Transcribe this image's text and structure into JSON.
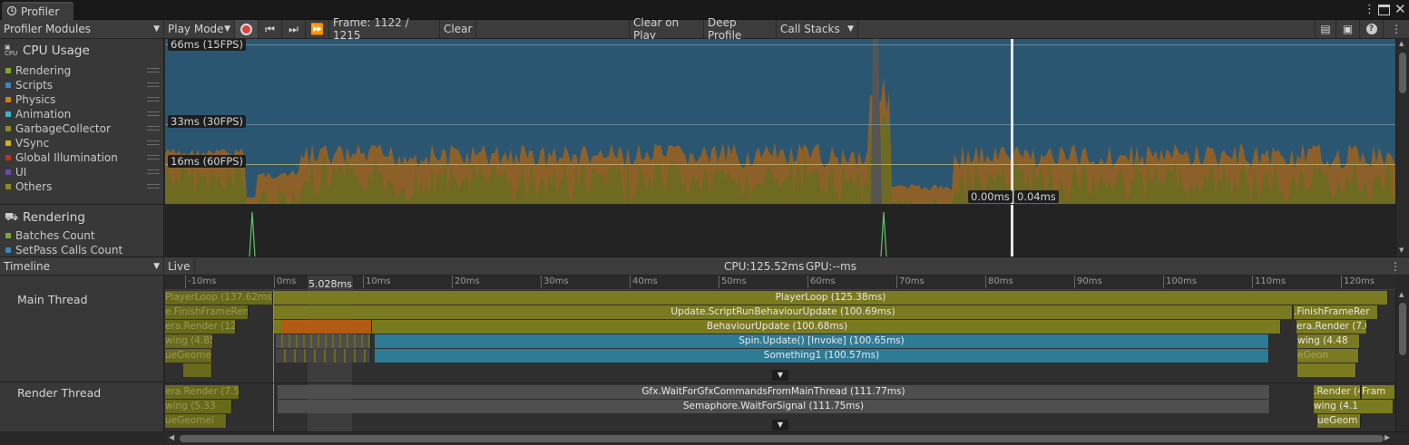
{
  "window": {
    "tab_title": "Profiler"
  },
  "toolbar": {
    "modules_label": "Profiler Modules",
    "play_mode_label": "Play Mode",
    "frame_label": "Frame: 1122 / 1215",
    "clear_label": "Clear",
    "clear_on_play_label": "Clear on Play",
    "deep_profile_label": "Deep Profile",
    "call_stacks_label": "Call Stacks"
  },
  "cpu_module": {
    "title": "CPU Usage",
    "legend": [
      {
        "label": "Rendering",
        "color": "#7fa82a"
      },
      {
        "label": "Scripts",
        "color": "#3a87bf"
      },
      {
        "label": "Physics",
        "color": "#d27b16"
      },
      {
        "label": "Animation",
        "color": "#3bb3c6"
      },
      {
        "label": "GarbageCollector",
        "color": "#8a8a2a"
      },
      {
        "label": "VSync",
        "color": "#d0b21a"
      },
      {
        "label": "Global Illumination",
        "color": "#b0391f"
      },
      {
        "label": "UI",
        "color": "#6a4aa8"
      },
      {
        "label": "Others",
        "color": "#8a8a24"
      }
    ],
    "gridlines": [
      "66ms (15FPS)",
      "33ms (30FPS)",
      "16ms (60FPS)"
    ],
    "selection_left": "0.00ms",
    "selection_right": "0.04ms"
  },
  "rendering_module": {
    "title": "Rendering",
    "legend": [
      {
        "label": "Batches Count",
        "color": "#7fa82a"
      },
      {
        "label": "SetPass Calls Count",
        "color": "#3a87bf"
      }
    ]
  },
  "timeline": {
    "view_label": "Timeline",
    "live_label": "Live",
    "cpu_label": "CPU:125.52ms",
    "gpu_label": "GPU:--ms",
    "selection_duration": "5.028ms",
    "ticks": [
      "-10ms",
      "0ms",
      "10ms",
      "20ms",
      "30ms",
      "40ms",
      "50ms",
      "60ms",
      "70ms",
      "80ms",
      "90ms",
      "100ms",
      "110ms",
      "120ms"
    ],
    "main_thread": {
      "label": "Main Thread",
      "bars": [
        "PlayerLoop (137.62ms)",
        "PlayerLoop (125.38ms)",
        "e.FinishFrameRende",
        "Update.ScriptRunBehaviourUpdate (100.69ms)",
        ".FinishFrameRer",
        "era.Render (12.0",
        "BehaviourUpdate (100.68ms)",
        "era.Render (7.0",
        "wing (4.85",
        "Spin.Update() [Invoke] (100.65ms)",
        "wing (4.48",
        "ueGeome",
        "Something1 (100.57ms)",
        "eGeon"
      ]
    },
    "render_thread": {
      "label": "Render Thread",
      "bars": [
        "era.Render (7.5",
        "Gfx.WaitForGfxCommandsFromMainThread (111.77ms)",
        ".Render (4",
        "Fram",
        "wing (5.33",
        "Semaphore.WaitForSignal (111.75ms)",
        "wing (4.1",
        "ueGeomel",
        "ueGeom"
      ]
    }
  }
}
